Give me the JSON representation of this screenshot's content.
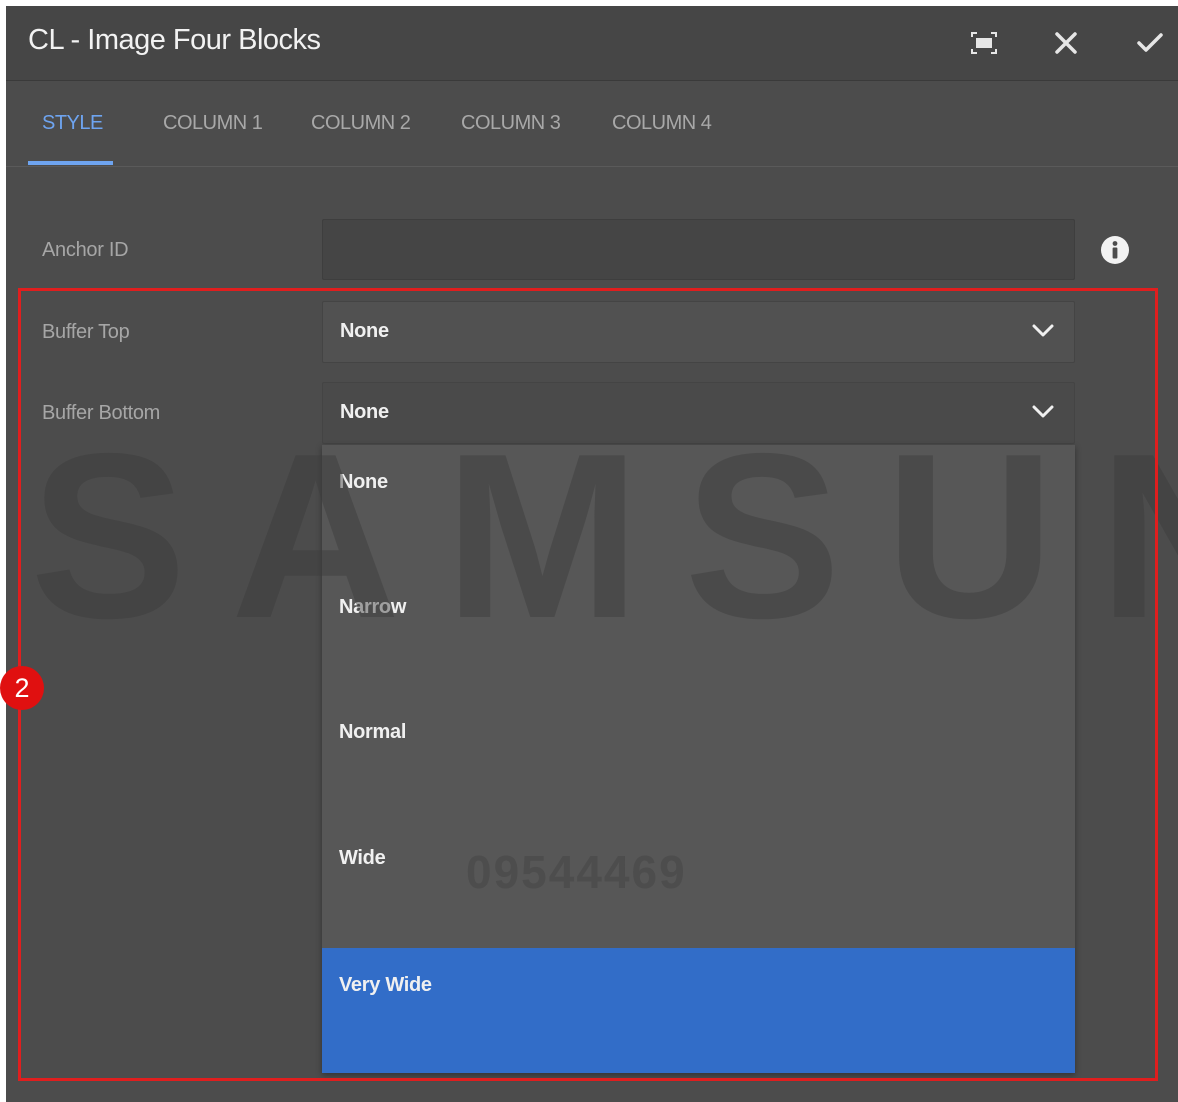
{
  "dialog": {
    "title": "CL - Image Four Blocks",
    "actions": [
      {
        "name": "fullscreen",
        "icon": "fullscreen-icon"
      },
      {
        "name": "close",
        "icon": "close-icon"
      },
      {
        "name": "done",
        "icon": "check-icon"
      }
    ]
  },
  "tabs": [
    {
      "label": "STYLE",
      "active": true
    },
    {
      "label": "COLUMN 1",
      "active": false
    },
    {
      "label": "COLUMN 2",
      "active": false
    },
    {
      "label": "COLUMN 3",
      "active": false
    },
    {
      "label": "COLUMN 4",
      "active": false
    }
  ],
  "form": {
    "anchor_id": {
      "label": "Anchor ID",
      "value": "",
      "info_icon": "info-icon"
    },
    "buffer_top": {
      "label": "Buffer Top",
      "value": "None"
    },
    "buffer_bottom": {
      "label": "Buffer Bottom",
      "value": "None",
      "options": [
        "None",
        "Narrow",
        "Normal",
        "Wide",
        "Very Wide"
      ],
      "highlighted_option": "Very Wide"
    }
  },
  "overlay": {
    "watermark_text": "SAMSUNG",
    "watermark_number": "09544469",
    "badge": "2"
  },
  "colors": {
    "accent": "#6ea4f0",
    "selected_option": "#326dc8",
    "highlight_box": "#e01e1e"
  }
}
